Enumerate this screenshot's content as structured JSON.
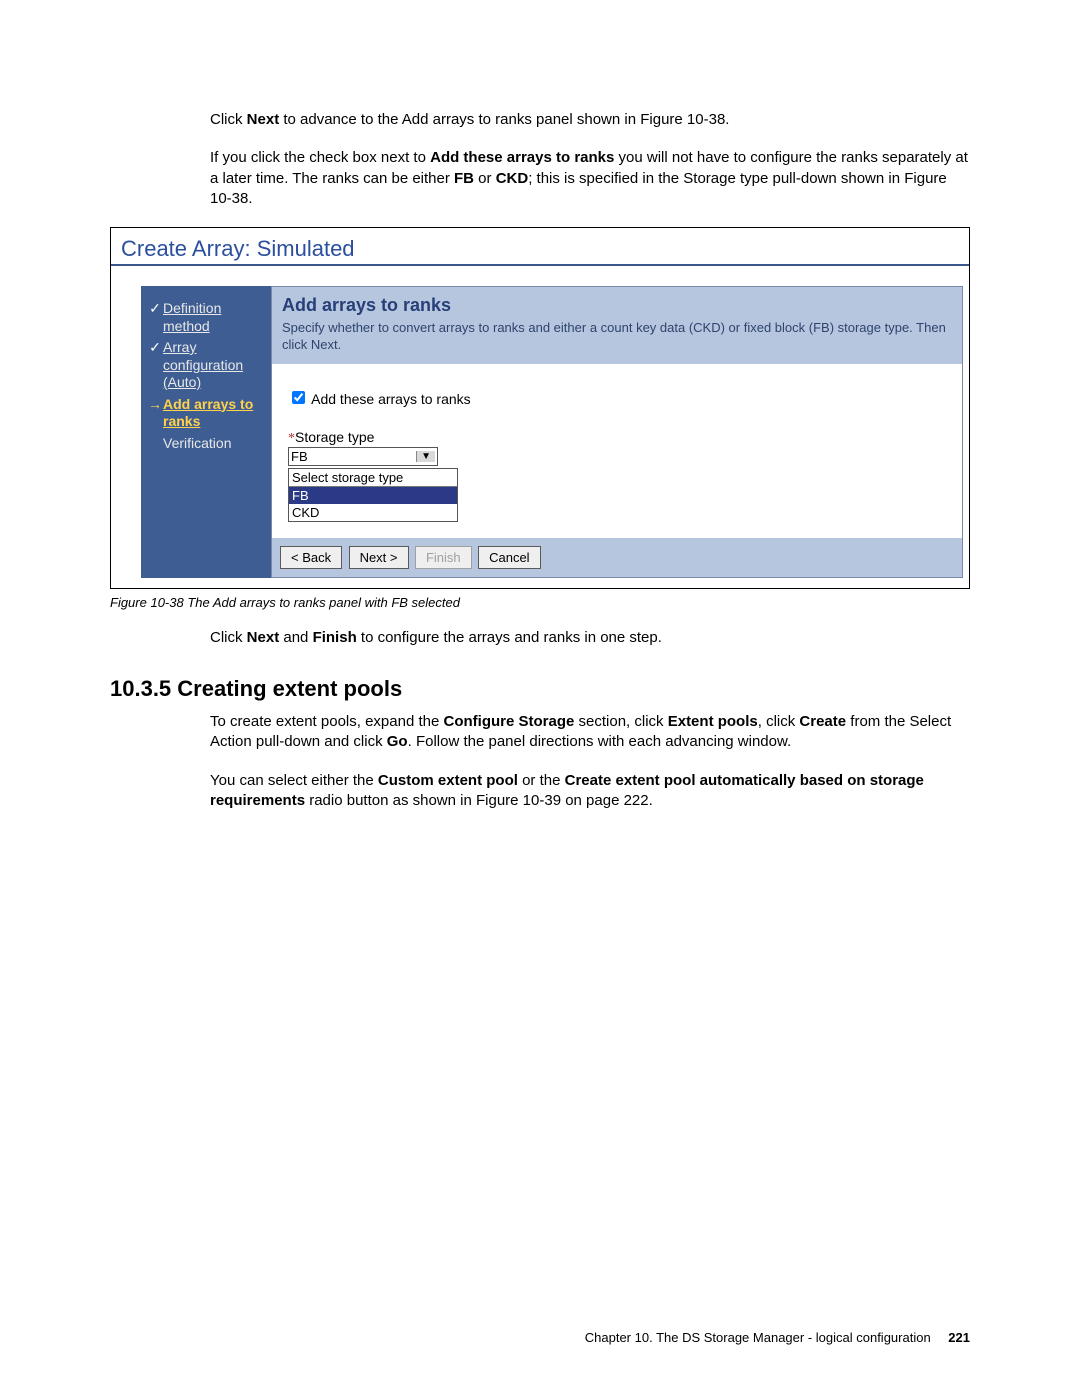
{
  "intro": {
    "p1_pre": "Click ",
    "p1_b1": "Next",
    "p1_post": " to advance to the Add arrays to ranks panel shown in Figure 10-38.",
    "p2_pre": "If you click the check box next to ",
    "p2_b1": "Add these arrays to ranks",
    "p2_mid1": " you will not have to configure the ranks separately at a later time. The ranks can be either ",
    "p2_b2": "FB",
    "p2_mid2": " or ",
    "p2_b3": "CKD",
    "p2_post": "; this is specified in the Storage type pull-down shown in Figure 10-38."
  },
  "figure": {
    "window_title": "Create Array: Simulated",
    "steps": {
      "s1": "Definition method",
      "s2": "Array configuration (Auto)",
      "s3": "Add arrays to ranks",
      "s4": "Verification",
      "check": "✓",
      "arrow": "→"
    },
    "panel": {
      "title": "Add arrays to ranks",
      "desc": "Specify whether to convert arrays to ranks and either a count key data (CKD) or fixed block (FB) storage type. Then click Next.",
      "checkbox_label": "Add these arrays to ranks",
      "storage_label": "Storage type",
      "star": "*",
      "select_value": "FB",
      "list_header": "Select storage type",
      "opt1": "FB",
      "opt2": "CKD"
    },
    "buttons": {
      "back": "< Back",
      "next": "Next >",
      "finish": "Finish",
      "cancel": "Cancel"
    }
  },
  "caption": "Figure 10-38   The Add arrays to ranks panel with FB selected",
  "after": {
    "p1_pre": "Click ",
    "p1_b1": "Next",
    "p1_mid": " and ",
    "p1_b2": "Finish",
    "p1_post": " to configure the arrays and ranks in one step."
  },
  "section_heading": "10.3.5  Creating extent pools",
  "sec": {
    "p1_pre": "To create extent pools, expand the ",
    "p1_b1": "Configure Storage",
    "p1_mid1": " section, click ",
    "p1_b2": "Extent pools",
    "p1_mid2": ", click ",
    "p1_b3": "Create",
    "p1_mid3": " from the Select Action pull-down and click ",
    "p1_b4": "Go",
    "p1_post": ". Follow the panel directions with each advancing window.",
    "p2_pre": "You can select either the ",
    "p2_b1": "Custom extent pool",
    "p2_mid": " or the ",
    "p2_b2": "Create extent pool automatically based on storage requirements",
    "p2_post": " radio button as shown in Figure 10-39 on page 222."
  },
  "footer": {
    "chapter": "Chapter 10. The DS Storage Manager - logical configuration",
    "page": "221"
  }
}
